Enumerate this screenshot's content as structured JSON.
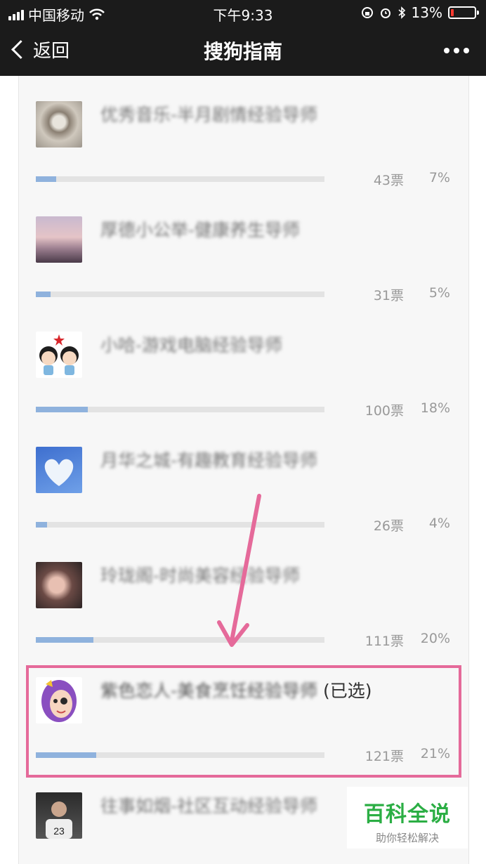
{
  "status_bar": {
    "carrier": "中国移动",
    "time": "下午9:33",
    "battery_percent": "13%",
    "battery_level": 0.13,
    "battery_color": "#ff3b30"
  },
  "nav": {
    "back_label": "返回",
    "title": "搜狗指南",
    "more_icon": "more-dots-icon"
  },
  "options": [
    {
      "name": "优秀音乐-半月剧情经验导师",
      "votes": "43票",
      "percent": "7%",
      "share": 0.07,
      "avatar": "abstract-sculpture"
    },
    {
      "name": "厚德小公举-健康养生导师",
      "votes": "31票",
      "percent": "5%",
      "share": 0.05,
      "avatar": "girl-sunset"
    },
    {
      "name": "小哈-游戏电脑经验导师",
      "votes": "100票",
      "percent": "18%",
      "share": 0.18,
      "avatar": "cartoon-kids"
    },
    {
      "name": "月华之城-有趣教育经验导师",
      "votes": "26票",
      "percent": "4%",
      "share": 0.04,
      "avatar": "heart-cloud"
    },
    {
      "name": "玲珑阁-时尚美容经验导师",
      "votes": "111票",
      "percent": "20%",
      "share": 0.2,
      "avatar": "girl-portrait"
    },
    {
      "name": "紫色恋人-美食烹饪经验导师",
      "selected_suffix": "(已选)",
      "votes": "121票",
      "percent": "21%",
      "share": 0.21,
      "avatar": "cartoon-purple-girl",
      "selected": true
    },
    {
      "name": "往事如烟-社区互动经验导师",
      "avatar": "jersey-boy"
    }
  ],
  "watermark": {
    "title": "百科全说",
    "subtitle": "助你轻松解决"
  },
  "colors": {
    "accent_pink": "#e56a9a",
    "progress_blue": "#8fb2dd",
    "watermark_green": "#2bae44"
  }
}
